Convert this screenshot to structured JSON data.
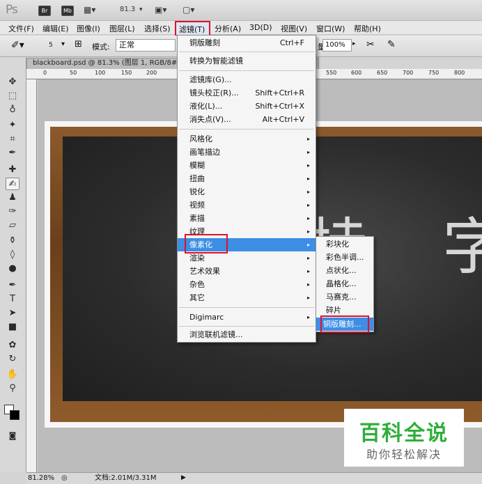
{
  "titlebar": {
    "app_logo": "Ps",
    "buttons": [
      "Br",
      "Mb"
    ],
    "zoom": "81.3"
  },
  "menubar": {
    "items": [
      "文件(F)",
      "编辑(E)",
      "图像(I)",
      "图层(L)",
      "选择(S)",
      "滤镜(T)",
      "分析(A)",
      "3D(D)",
      "视图(V)",
      "窗口(W)",
      "帮助(H)"
    ],
    "active": "滤镜(T)"
  },
  "optionsbar": {
    "brush_size": "5",
    "mode_label": "模式:",
    "mode_value": "正常",
    "flow_label": "量:",
    "flow_value": "100%"
  },
  "document": {
    "tab_title": "blackboard.psd @ 81.3% (图层 1, RGB/8#)",
    "ruler_ticks": [
      "0",
      "50",
      "100",
      "150",
      "200",
      "550",
      "600",
      "650",
      "700",
      "750",
      "800"
    ],
    "chalk_text": "特 字"
  },
  "filter_menu": {
    "items": [
      {
        "label": "铜版雕刻",
        "shortcut": "Ctrl+F"
      },
      {
        "label": "转换为智能滤镜",
        "shortcut": ""
      },
      {
        "label": "滤镜库(G)...",
        "shortcut": ""
      },
      {
        "label": "镜头校正(R)...",
        "shortcut": "Shift+Ctrl+R"
      },
      {
        "label": "液化(L)...",
        "shortcut": "Shift+Ctrl+X"
      },
      {
        "label": "消失点(V)...",
        "shortcut": "Alt+Ctrl+V"
      },
      {
        "label": "风格化",
        "shortcut": ""
      },
      {
        "label": "画笔描边",
        "shortcut": ""
      },
      {
        "label": "模糊",
        "shortcut": ""
      },
      {
        "label": "扭曲",
        "shortcut": ""
      },
      {
        "label": "锐化",
        "shortcut": ""
      },
      {
        "label": "视频",
        "shortcut": ""
      },
      {
        "label": "素描",
        "shortcut": ""
      },
      {
        "label": "纹理",
        "shortcut": ""
      },
      {
        "label": "像素化",
        "shortcut": ""
      },
      {
        "label": "渲染",
        "shortcut": ""
      },
      {
        "label": "艺术效果",
        "shortcut": ""
      },
      {
        "label": "杂色",
        "shortcut": ""
      },
      {
        "label": "其它",
        "shortcut": ""
      },
      {
        "label": "Digimarc",
        "shortcut": ""
      },
      {
        "label": "浏览联机滤镜...",
        "shortcut": ""
      }
    ],
    "submenu_arrow": "▸"
  },
  "pixelate_submenu": {
    "items": [
      "彩块化",
      "彩色半调...",
      "点状化...",
      "晶格化...",
      "马赛克...",
      "碎片",
      "铜版雕刻..."
    ]
  },
  "statusbar": {
    "zoom": "81.28%",
    "doc_info": "文档:2.01M/3.31M"
  },
  "watermark": {
    "title": "百科全说",
    "subtitle": "助你轻松解决"
  },
  "colors": {
    "highlight": "#3d8ee4",
    "annotation_red": "#e0102a",
    "watermark_green": "#2fae3a"
  }
}
